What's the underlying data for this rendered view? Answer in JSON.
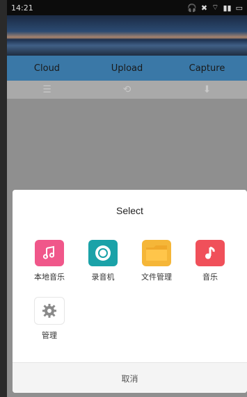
{
  "status_bar": {
    "time": "14:21"
  },
  "tabs": [
    {
      "label": "Cloud"
    },
    {
      "label": "Upload"
    },
    {
      "label": "Capture"
    }
  ],
  "dialog": {
    "title": "Select",
    "apps": [
      {
        "label": "本地音乐",
        "icon": "music-note-icon",
        "color": "#f0578a"
      },
      {
        "label": "录音机",
        "icon": "record-icon",
        "color": "#1aa2a8"
      },
      {
        "label": "文件管理",
        "icon": "folder-icon",
        "color": "#f5b638"
      },
      {
        "label": "音乐",
        "icon": "music-icon",
        "color": "#f0505a"
      },
      {
        "label": "管理",
        "icon": "gear-icon",
        "color": "#ffffff"
      }
    ],
    "cancel_label": "取消"
  }
}
